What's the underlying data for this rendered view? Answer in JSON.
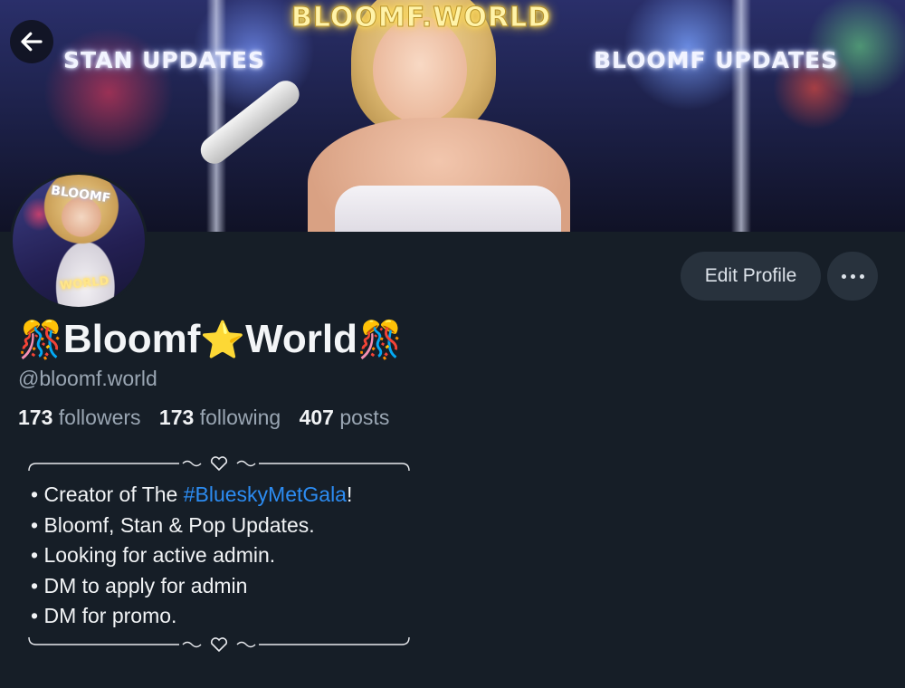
{
  "banner": {
    "text_top": "BLOOMF.WORLD",
    "text_left": "STAN UPDATES",
    "text_right": "BLOOMF UPDATES"
  },
  "avatar": {
    "text_top": "BLOOMF",
    "text_bottom": "WORLD"
  },
  "actions": {
    "edit_profile": "Edit Profile",
    "more_icon": "ellipsis-icon",
    "back_icon": "arrow-left-icon"
  },
  "profile": {
    "emoji_left": "🎊",
    "name_part1": "Bloomf",
    "star_emoji": "⭐",
    "name_part2": "World",
    "emoji_right": "🎊",
    "handle": "@bloomf.world"
  },
  "stats": {
    "followers_count": "173",
    "followers_label": "followers",
    "following_count": "173",
    "following_label": "following",
    "posts_count": "407",
    "posts_label": "posts"
  },
  "bio": {
    "line1_prefix": "Creator of The ",
    "line1_hashtag": "#BlueskyMetGala",
    "line1_suffix": "!",
    "line2": "Bloomf, Stan & Pop Updates.",
    "line3": "Looking for active admin.",
    "line4": "DM to apply for admin",
    "line5": "DM for promo."
  },
  "colors": {
    "background": "#161e27",
    "button_bg": "#28323d",
    "muted_text": "#9aa6b3",
    "link": "#2c8cf2"
  }
}
